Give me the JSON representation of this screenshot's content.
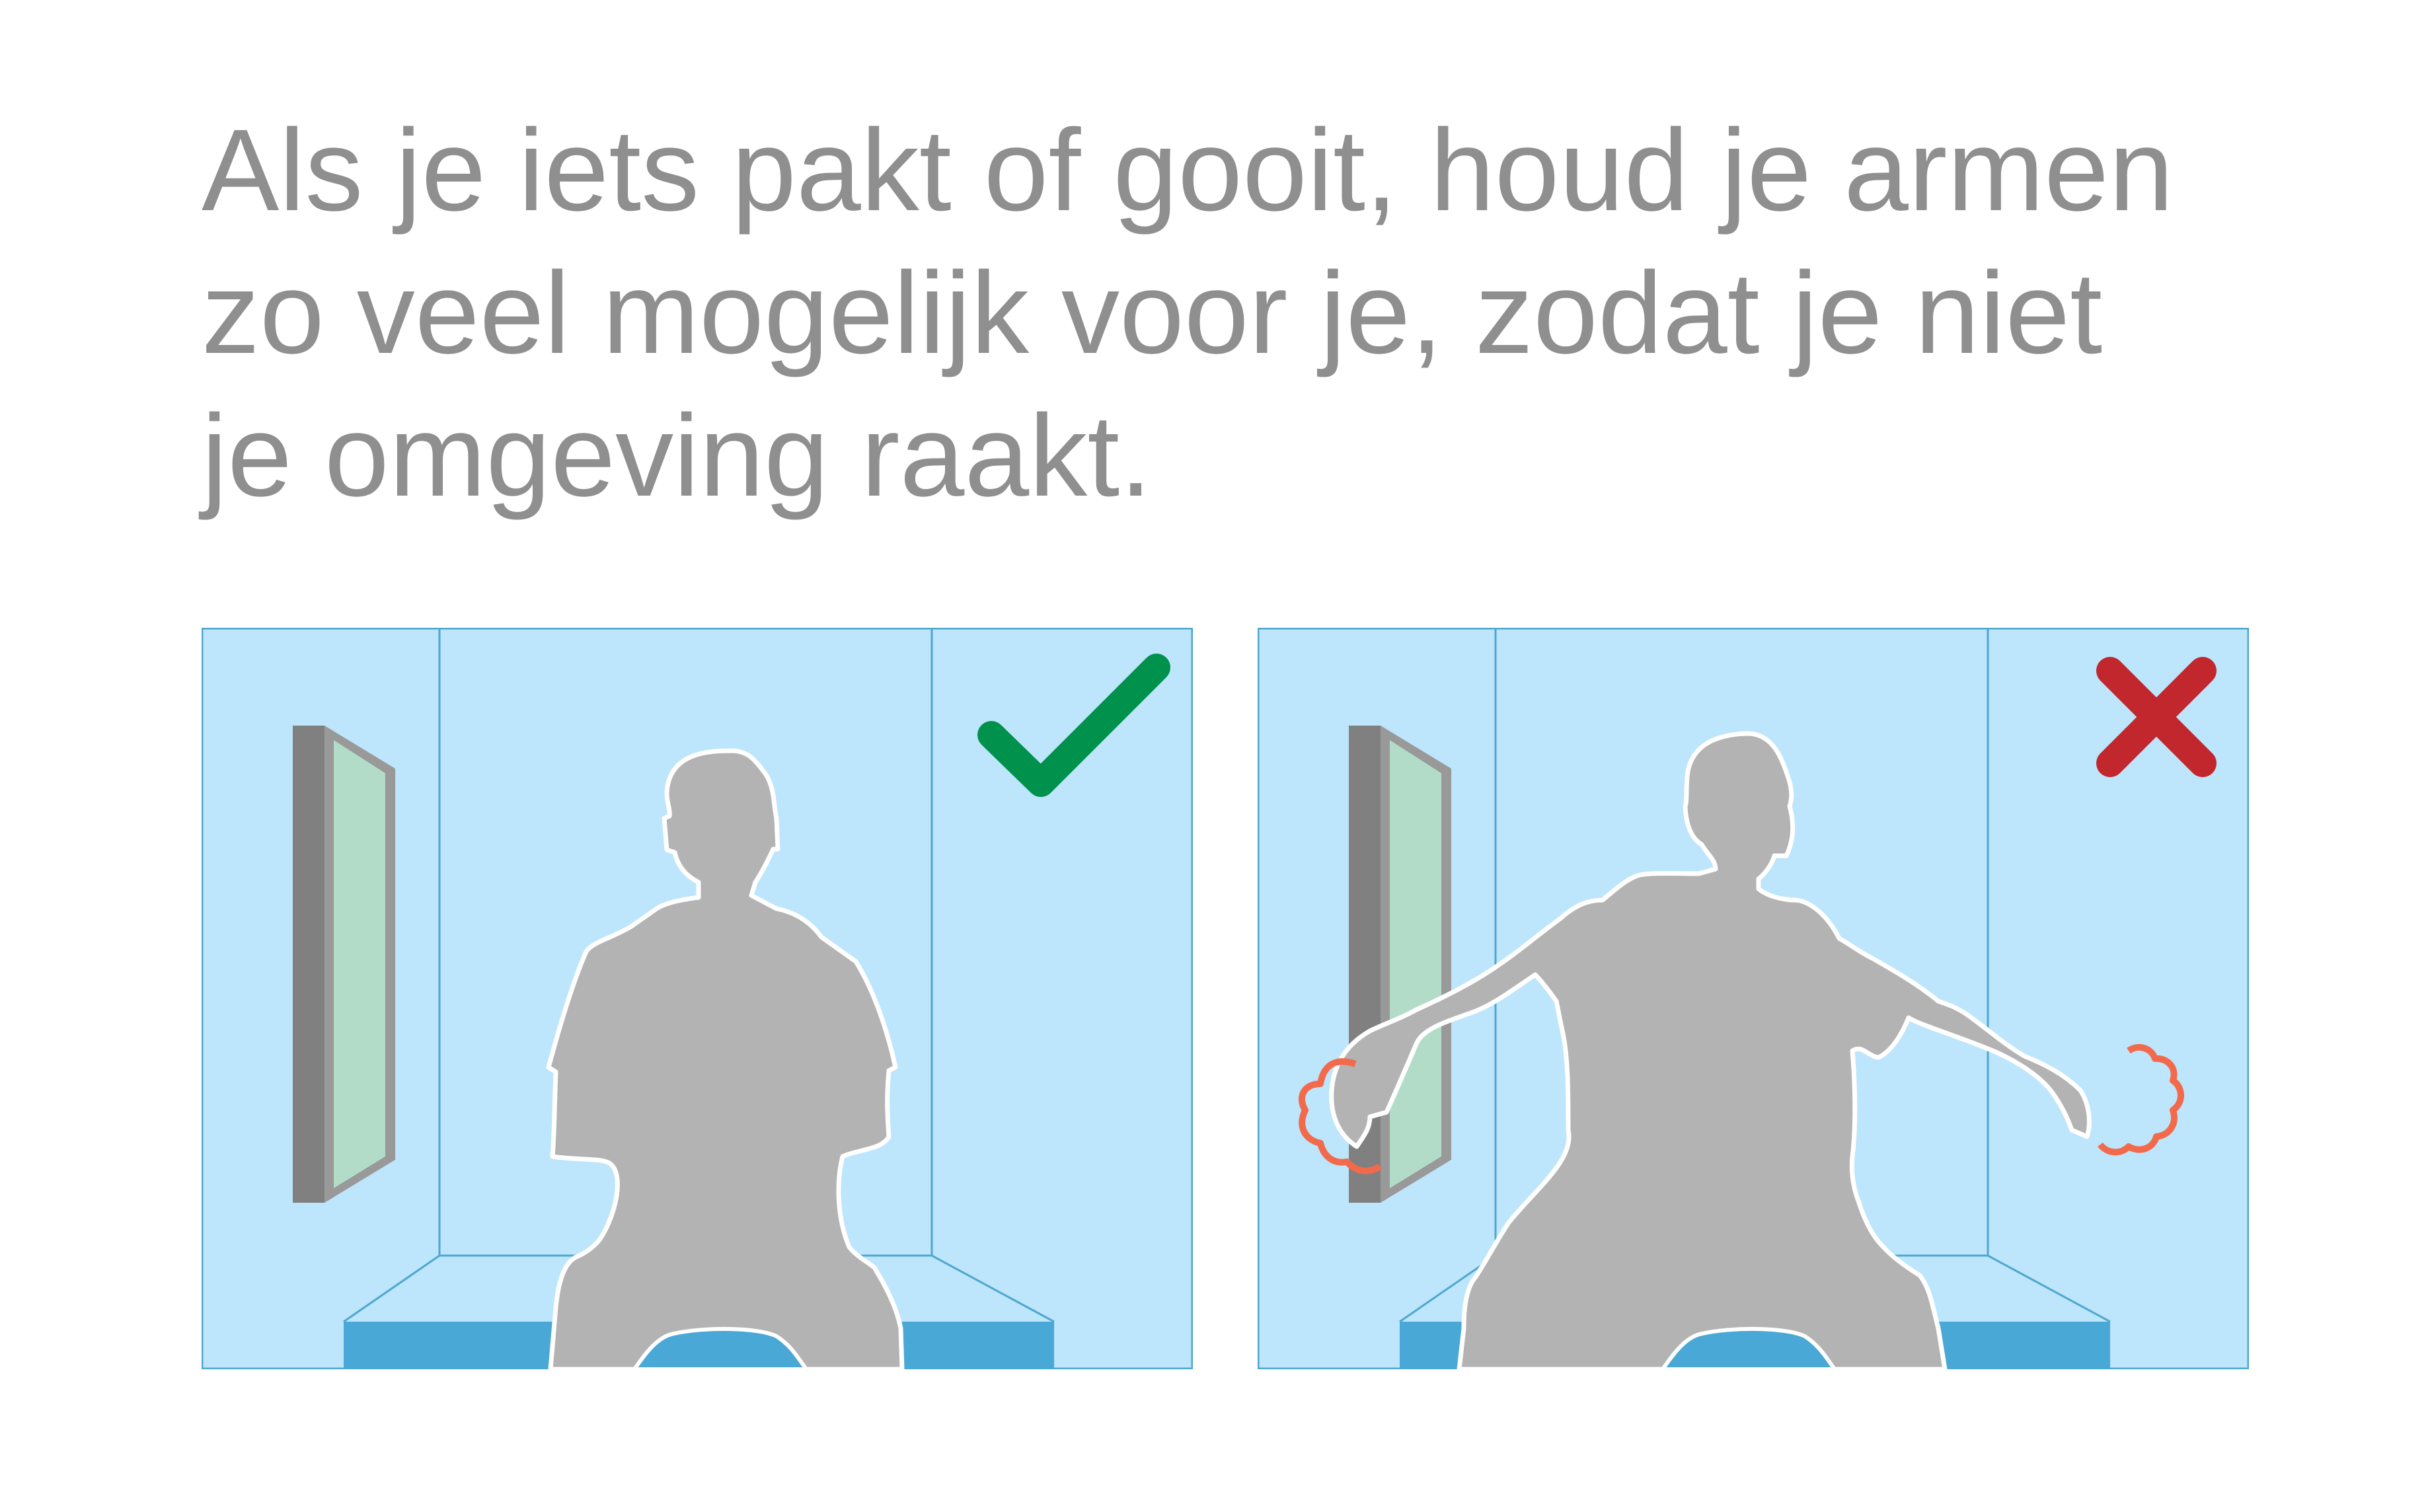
{
  "caption": {
    "lines": [
      "Als je iets pakt of gooit, houd je armen",
      "zo veel mogelijk voor je, zodat je niet",
      "je omgeving raakt."
    ]
  },
  "panels": [
    {
      "verdict": "correct",
      "icon": "checkmark-icon",
      "color": "#00914c"
    },
    {
      "verdict": "incorrect",
      "icon": "cross-icon",
      "color": "#c1272d"
    }
  ],
  "colors": {
    "room": "#bde5fb",
    "room_lines": "#4ea7cf",
    "couch": "#4aa8d6",
    "person": "#b3b3b3",
    "window_frame": "#808080",
    "window_glass": "#b3dcc8",
    "impact": "#f26a4b"
  }
}
